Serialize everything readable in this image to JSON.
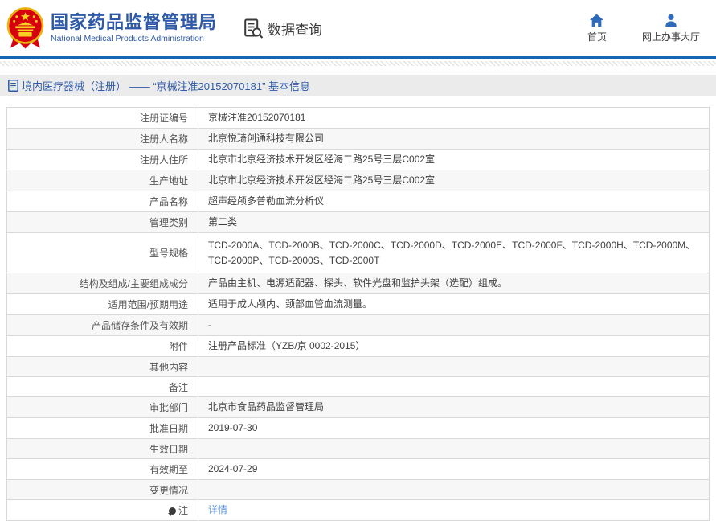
{
  "header": {
    "agency_name_zh": "国家药品监督管理局",
    "agency_name_en": "National Medical Products Administration",
    "data_query_label": "数据查询",
    "nav": [
      {
        "label": "首页",
        "icon": "home-icon"
      },
      {
        "label": "网上办事大厅",
        "icon": "user-icon"
      }
    ]
  },
  "breadcrumb": {
    "text": "境内医疗器械（注册） —— “京械注准20152070181” 基本信息"
  },
  "table": {
    "rows": [
      {
        "label": "注册证编号",
        "value": "京械注准20152070181"
      },
      {
        "label": "注册人名称",
        "value": "北京悦琦创通科技有限公司"
      },
      {
        "label": "注册人住所",
        "value": "北京市北京经济技术开发区经海二路25号三层C002室"
      },
      {
        "label": "生产地址",
        "value": "北京市北京经济技术开发区经海二路25号三层C002室"
      },
      {
        "label": "产品名称",
        "value": "超声经颅多普勒血流分析仪"
      },
      {
        "label": "管理类别",
        "value": "第二类"
      },
      {
        "label": "型号规格",
        "value": "TCD-2000A、TCD-2000B、TCD-2000C、TCD-2000D、TCD-2000E、TCD-2000F、TCD-2000H、TCD-2000M、TCD-2000P、TCD-2000S、TCD-2000T",
        "tall": true
      },
      {
        "label": "结构及组成/主要组成成分",
        "value": "产品由主机、电源适配器、探头、软件光盘和监护头架（选配）组成。"
      },
      {
        "label": "适用范围/预期用途",
        "value": "适用于成人颅内、颈部血管血流测量。"
      },
      {
        "label": "产品储存条件及有效期",
        "value": "-"
      },
      {
        "label": "附件",
        "value": "注册产品标准（YZB/京 0002-2015）"
      },
      {
        "label": "其他内容",
        "value": ""
      },
      {
        "label": "备注",
        "value": ""
      },
      {
        "label": "审批部门",
        "value": "北京市食品药品监督管理局"
      },
      {
        "label": "批准日期",
        "value": "2019-07-30"
      },
      {
        "label": "生效日期",
        "value": ""
      },
      {
        "label": "有效期至",
        "value": "2024-07-29"
      },
      {
        "label": "变更情况",
        "value": ""
      },
      {
        "label": "注",
        "value": "详情",
        "link": true,
        "icon": "note"
      }
    ]
  },
  "colors": {
    "accent-blue": "#2e5aa7",
    "nav-icon-blue": "#2f6bbc",
    "header-line-blue": "#1766b5",
    "link-blue": "#5b8fd9",
    "breadcrumb-bg": "#ebebeb",
    "table-border": "#d8d8d8",
    "alt-row-bg": "#f7f7f7",
    "emblem-red": "#d6000f",
    "emblem-gold": "#f0c41e"
  }
}
